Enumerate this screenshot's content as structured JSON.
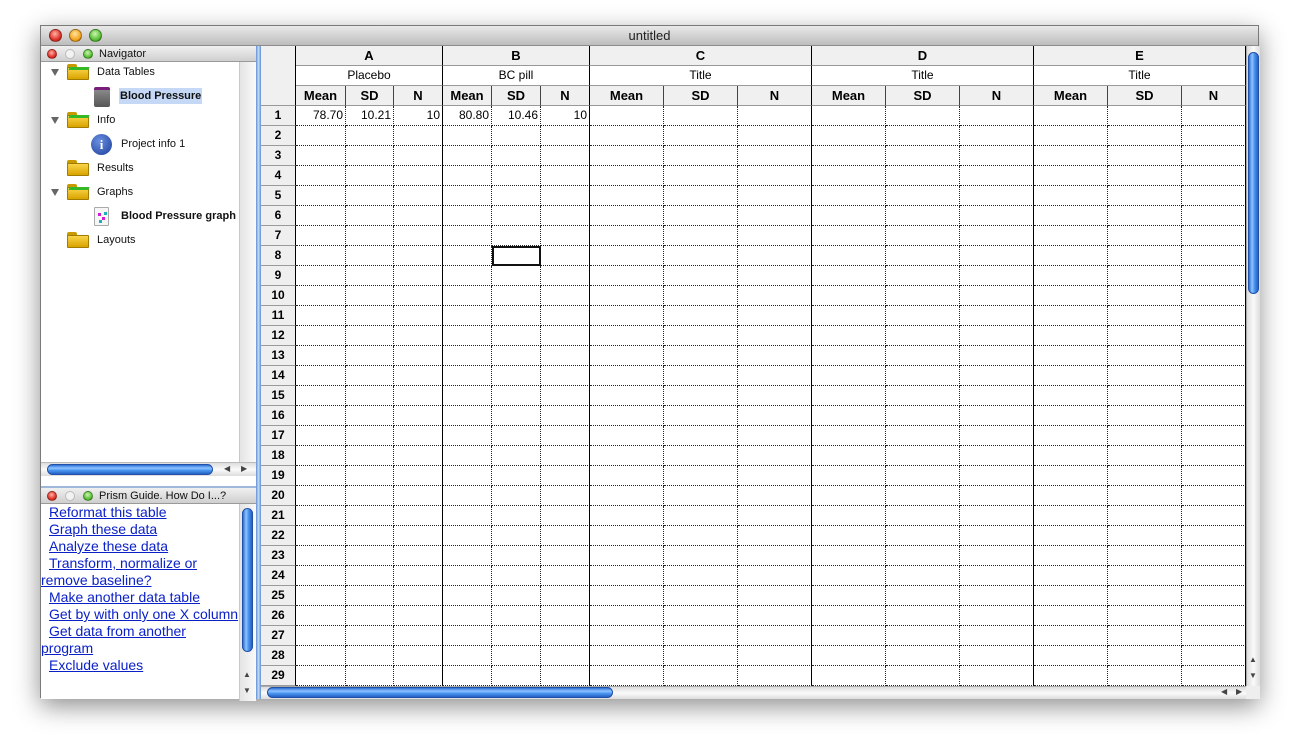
{
  "window": {
    "title": "untitled"
  },
  "navigator": {
    "title": "Navigator",
    "items": [
      {
        "label": "Data Tables",
        "type": "folder",
        "expanded": true,
        "level": 0
      },
      {
        "label": "Blood Pressure",
        "type": "data-table",
        "level": 1,
        "selected": true
      },
      {
        "label": "Info",
        "type": "folder",
        "expanded": true,
        "level": 0
      },
      {
        "label": "Project info 1",
        "type": "info",
        "level": 1
      },
      {
        "label": "Results",
        "type": "folder",
        "expanded": false,
        "level": 0
      },
      {
        "label": "Graphs",
        "type": "folder",
        "expanded": true,
        "level": 0
      },
      {
        "label": "Blood Pressure graph",
        "type": "graph",
        "level": 1
      },
      {
        "label": "Layouts",
        "type": "folder",
        "expanded": false,
        "level": 0
      }
    ]
  },
  "guide": {
    "title": "Prism Guide. How Do I...?",
    "links": [
      "Reformat this table",
      "Graph these data",
      "Analyze these data",
      "Transform, normalize or remove baseline?",
      "Make another data table",
      "Get by with only one X column",
      "Get data from another program",
      "Exclude values"
    ]
  },
  "table": {
    "groups": [
      {
        "letter": "A",
        "title": "Placebo",
        "cols": [
          "Mean",
          "SD",
          "N"
        ]
      },
      {
        "letter": "B",
        "title": "BC pill",
        "cols": [
          "Mean",
          "SD",
          "N"
        ]
      },
      {
        "letter": "C",
        "title": "Title",
        "cols": [
          "Mean",
          "SD",
          "N"
        ]
      },
      {
        "letter": "D",
        "title": "Title",
        "cols": [
          "Mean",
          "SD",
          "N"
        ]
      },
      {
        "letter": "E",
        "title": "Title",
        "cols": [
          "Mean",
          "SD",
          "N"
        ]
      }
    ],
    "row_count": 29,
    "rows": [
      [
        "78.70",
        "10.21",
        "10",
        "80.80",
        "10.46",
        "10",
        "",
        "",
        "",
        "",
        "",
        "",
        "",
        "",
        ""
      ]
    ],
    "selected_cell": {
      "row": 8,
      "col": 4
    }
  }
}
